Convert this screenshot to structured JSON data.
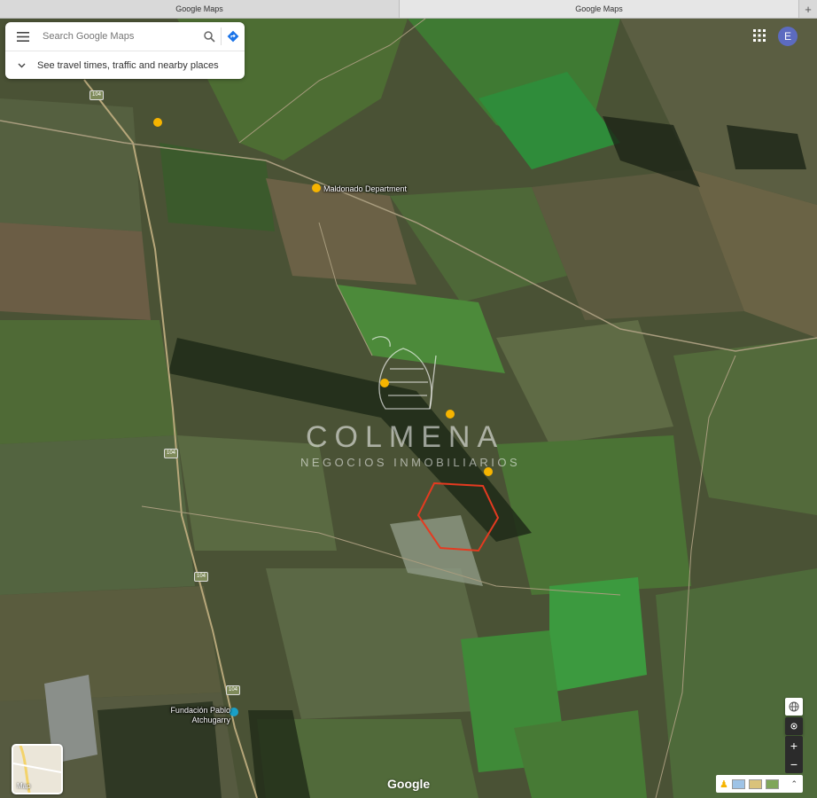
{
  "browser": {
    "tabs": [
      {
        "title": "Google Maps"
      },
      {
        "title": "Google Maps"
      }
    ],
    "new_tab_label": "+"
  },
  "search": {
    "placeholder": "Search Google Maps",
    "travel_text": "See travel times, traffic and nearby places",
    "icons": [
      "menu-icon",
      "search-icon",
      "directions-icon",
      "chevron-down-icon"
    ]
  },
  "account": {
    "avatar_letter": "E",
    "apps_icon": "apps-grid-icon"
  },
  "map": {
    "places": [
      {
        "name": "Maldonado Department"
      },
      {
        "name": "Fundación Pablo Atchugarry"
      }
    ],
    "route_number": "104",
    "watermark": {
      "title": "COLMENA",
      "subtitle": "NEGOCIOS INMOBILIARIOS"
    },
    "colors": {
      "field_dark": "#3f4a2e",
      "field_green": "#4f7a35",
      "field_brown": "#6b6146",
      "polygon": "#e53a20",
      "pin": "#f6b400"
    }
  },
  "controls": {
    "map_type_label": "Map",
    "zoom_in": "+",
    "zoom_out": "−",
    "logo": "Google"
  }
}
